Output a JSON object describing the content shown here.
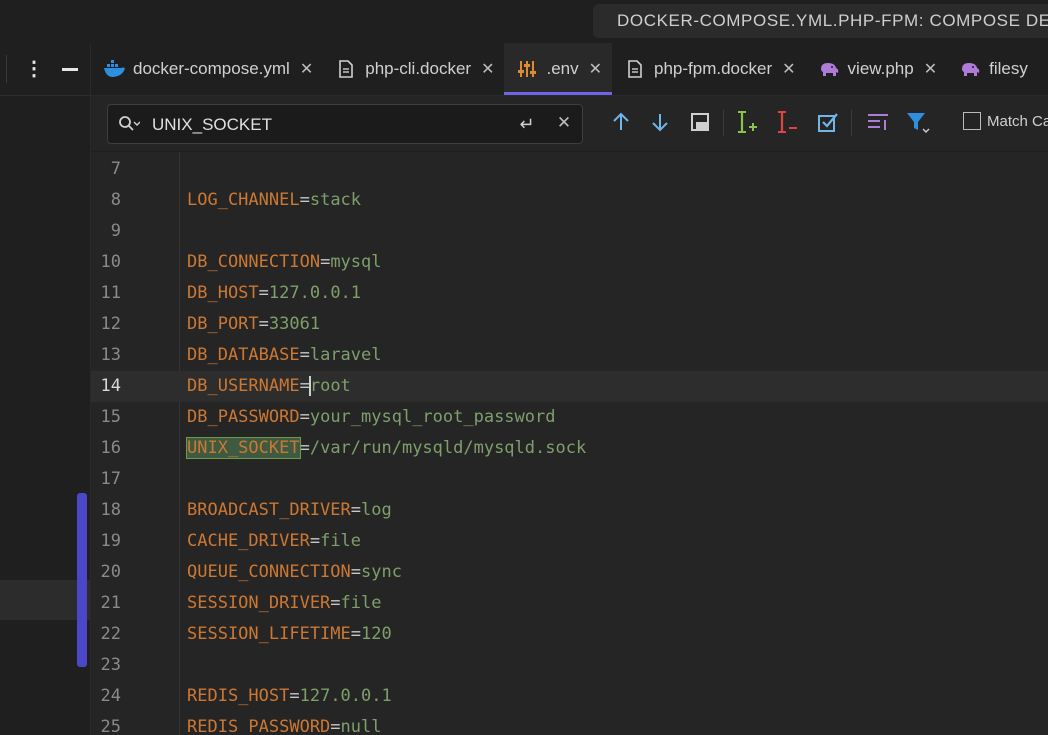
{
  "window": {
    "title": "DOCKER-COMPOSE.YML.PHP-FPM: COMPOSE DEPL",
    "title_icon": "docker-whale-icon"
  },
  "sidebar": {
    "menu_icon": "kebab-menu-icon",
    "minimize_icon": "minimize-icon"
  },
  "tabs": [
    {
      "label": "docker-compose.yml",
      "icon": "docker-whale-icon",
      "close": "✕",
      "active": false
    },
    {
      "label": "php-cli.docker",
      "icon": "file-icon",
      "close": "✕",
      "active": false
    },
    {
      "label": ".env",
      "icon": "settings-sliders-icon",
      "close": "✕",
      "active": true
    },
    {
      "label": "php-fpm.docker",
      "icon": "file-icon",
      "close": "✕",
      "active": false
    },
    {
      "label": "view.php",
      "icon": "php-elephant-icon",
      "close": "✕",
      "active": false
    },
    {
      "label": "filesy",
      "icon": "php-elephant-icon",
      "close": "",
      "active": false
    }
  ],
  "find": {
    "query": "UNIX_SOCKET",
    "enter_glyph": "↵",
    "clear_glyph": "✕",
    "match_case_label": "Match Ca",
    "match_case_checked": false
  },
  "editor": {
    "current_line": "14",
    "lines": [
      {
        "n": "7",
        "key": "",
        "eq": "",
        "val": ""
      },
      {
        "n": "8",
        "key": "LOG_CHANNEL",
        "eq": "=",
        "val": "stack"
      },
      {
        "n": "9",
        "key": "",
        "eq": "",
        "val": ""
      },
      {
        "n": "10",
        "key": "DB_CONNECTION",
        "eq": "=",
        "val": "mysql"
      },
      {
        "n": "11",
        "key": "DB_HOST",
        "eq": "=",
        "val": "127.0.0.1"
      },
      {
        "n": "12",
        "key": "DB_PORT",
        "eq": "=",
        "val": "33061"
      },
      {
        "n": "13",
        "key": "DB_DATABASE",
        "eq": "=",
        "val": "laravel"
      },
      {
        "n": "14",
        "key": "DB_USERNAME",
        "eq": "=",
        "val": "root"
      },
      {
        "n": "15",
        "key": "DB_PASSWORD",
        "eq": "=",
        "val": "your_mysql_root_password"
      },
      {
        "n": "16",
        "key": "UNIX_SOCKET",
        "eq": "=",
        "val": "/var/run/mysqld/mysqld.sock"
      },
      {
        "n": "17",
        "key": "",
        "eq": "",
        "val": ""
      },
      {
        "n": "18",
        "key": "BROADCAST_DRIVER",
        "eq": "=",
        "val": "log"
      },
      {
        "n": "19",
        "key": "CACHE_DRIVER",
        "eq": "=",
        "val": "file"
      },
      {
        "n": "20",
        "key": "QUEUE_CONNECTION",
        "eq": "=",
        "val": "sync"
      },
      {
        "n": "21",
        "key": "SESSION_DRIVER",
        "eq": "=",
        "val": "file"
      },
      {
        "n": "22",
        "key": "SESSION_LIFETIME",
        "eq": "=",
        "val": "120"
      },
      {
        "n": "23",
        "key": "",
        "eq": "",
        "val": ""
      },
      {
        "n": "24",
        "key": "REDIS_HOST",
        "eq": "=",
        "val": "127.0.0.1"
      },
      {
        "n": "25",
        "key": "REDIS_PASSWORD",
        "eq": "=",
        "val": "null"
      }
    ]
  },
  "colors": {
    "accent": "#6f63e8",
    "key": "#cc7832",
    "value": "#7f9f6a",
    "match_highlight": "#3e5a41"
  }
}
